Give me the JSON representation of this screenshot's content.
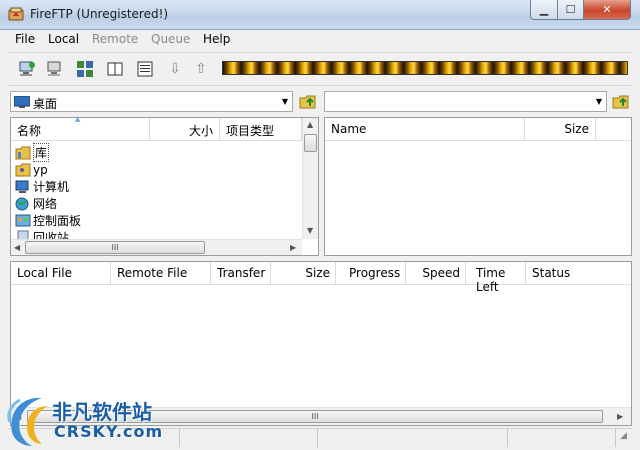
{
  "window": {
    "title": "FireFTP (Unregistered!)"
  },
  "menu": [
    "File",
    "Local",
    "Remote",
    "Queue",
    "Help"
  ],
  "toolbar": {
    "icons": [
      "connect-icon",
      "disconnect-icon",
      "site-manager-icon",
      "log-icon",
      "properties-icon",
      "download-icon",
      "upload-icon"
    ]
  },
  "local": {
    "path": "桌面",
    "columns": [
      "名称",
      "大小",
      "项目类型"
    ],
    "items": [
      {
        "name": "库",
        "icon": "library-folder-icon"
      },
      {
        "name": "yp",
        "icon": "user-folder-icon"
      },
      {
        "name": "计算机",
        "icon": "computer-icon"
      },
      {
        "name": "网络",
        "icon": "network-icon"
      },
      {
        "name": "控制面板",
        "icon": "control-panel-icon"
      },
      {
        "name": "回收站",
        "icon": "recycle-bin-icon"
      }
    ]
  },
  "remote": {
    "path": "",
    "columns": [
      "Name",
      "Size"
    ]
  },
  "queue": {
    "columns": [
      "Local File",
      "Remote File",
      "Transfer",
      "Size",
      "Progress",
      "Speed",
      "Time Left",
      "Status"
    ]
  },
  "scrollbar": {
    "grip": "III"
  },
  "watermark": {
    "cn": "非凡软件站",
    "en": "CRSKY.com"
  },
  "colors": {
    "accent": "#1a5ea8",
    "titlebar": "#c7d7ec",
    "close": "#c9462c"
  }
}
